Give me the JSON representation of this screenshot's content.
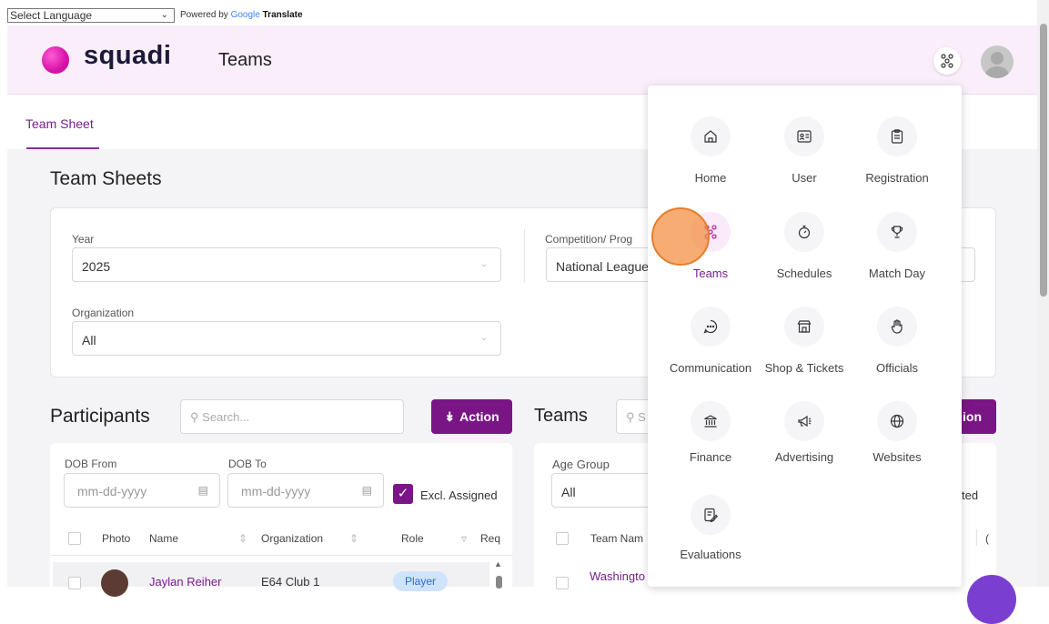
{
  "translate": {
    "select_value": "Select Language",
    "powered_by": "Powered by",
    "google": "Google",
    "translate": "Translate"
  },
  "header": {
    "brand": "squadi",
    "title": "Teams",
    "apps_icon": "teams-cluster-icon",
    "avatar_icon": "user-avatar"
  },
  "tabs": [
    {
      "label": "Team Sheet",
      "active": true
    }
  ],
  "page": {
    "title": "Team Sheets"
  },
  "filters": {
    "year": {
      "label": "Year",
      "value": "2025"
    },
    "competition": {
      "label": "Competition/ Prog",
      "value": "National League"
    },
    "organization": {
      "label": "Organization",
      "value": "All"
    }
  },
  "participants": {
    "title": "Participants",
    "search_placeholder": "Search...",
    "action_label": "Action",
    "dob_from": {
      "label": "DOB From",
      "placeholder": "mm-dd-yyyy"
    },
    "dob_to": {
      "label": "DOB To",
      "placeholder": "mm-dd-yyyy"
    },
    "excl_assigned": "Excl. Assigned",
    "columns": [
      "Photo",
      "Name",
      "Organization",
      "Role",
      "Req"
    ],
    "rows": [
      {
        "name": "Jaylan Reiher",
        "organization": "E64 Club 1",
        "role": "Player"
      }
    ]
  },
  "teams": {
    "title": "Teams",
    "search_placeholder": "S",
    "action_label": "ion",
    "age_group": {
      "label": "Age Group",
      "value": "All"
    },
    "partial_label": "ted",
    "columns": [
      "Team Nam"
    ],
    "rows": [
      {
        "team": "Washingto"
      }
    ]
  },
  "app_menu": {
    "items": [
      {
        "label": "Home",
        "icon": "home-icon"
      },
      {
        "label": "User",
        "icon": "id-card-icon"
      },
      {
        "label": "Registration",
        "icon": "clipboard-icon"
      },
      {
        "label": "Teams",
        "icon": "teams-icon"
      },
      {
        "label": "Schedules",
        "icon": "stopwatch-icon"
      },
      {
        "label": "Match Day",
        "icon": "trophy-icon"
      },
      {
        "label": "Communication",
        "icon": "chat-icon"
      },
      {
        "label": "Shop & Tickets",
        "icon": "shop-icon"
      },
      {
        "label": "Officials",
        "icon": "hand-icon"
      },
      {
        "label": "Finance",
        "icon": "bank-icon"
      },
      {
        "label": "Advertising",
        "icon": "megaphone-icon"
      },
      {
        "label": "Websites",
        "icon": "globe-icon"
      },
      {
        "label": "Evaluations",
        "icon": "notes-icon"
      }
    ]
  },
  "colors": {
    "accent": "#7a1585",
    "header_bg": "#f9eefa",
    "marker": "#f28c3c"
  }
}
